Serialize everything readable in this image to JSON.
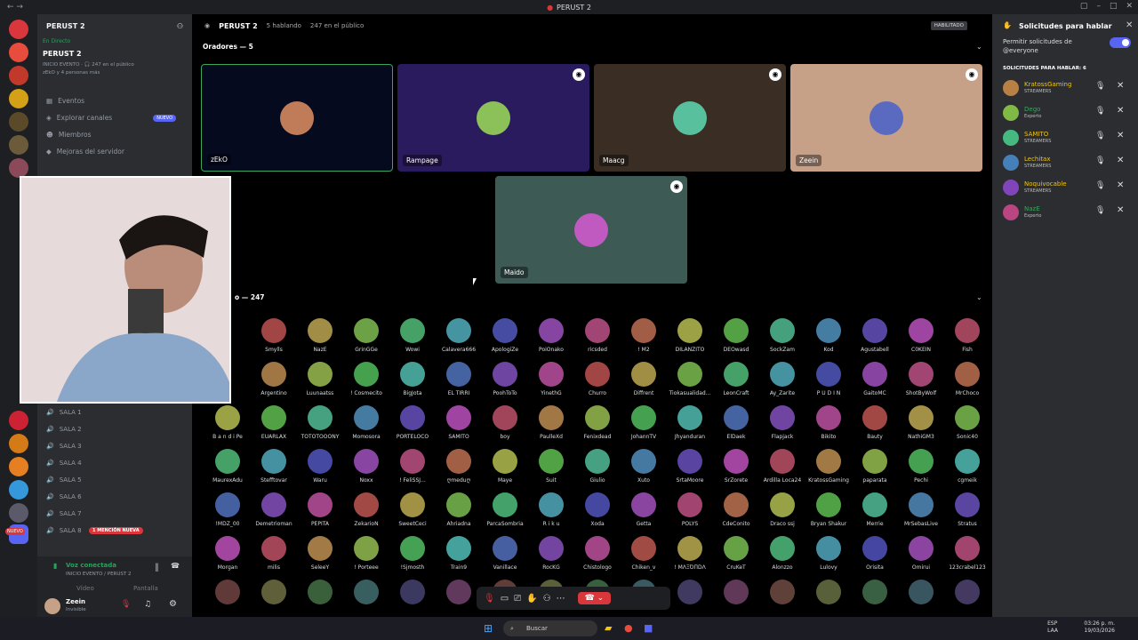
{
  "window": {
    "title": "PERUST 2"
  },
  "server": {
    "name": "PERUST 2",
    "live_label": "En Directo",
    "event_name": "PERUST 2",
    "event_sub": "INICIO EVENTO · 🎧 247 en el público",
    "event_people": "zEkO y 4 personas más"
  },
  "channel_menu": [
    {
      "label": "Eventos"
    },
    {
      "label": "Explorar canales",
      "badge": "NUEVO"
    },
    {
      "label": "Miembros"
    },
    {
      "label": "Mejoras del servidor"
    }
  ],
  "salas": [
    "SALA 1",
    "SALA 2",
    "SALA 3",
    "SALA 4",
    "SALA 5",
    "SALA 6",
    "SALA 7",
    "SALA 8"
  ],
  "mention_badge": "1 MENCIÓN NUEVA",
  "new_badge": "NUEVO",
  "voice": {
    "status": "Voz conectada",
    "channel": "INICIO EVENTO / PERUST 2",
    "video": "Vídeo",
    "screen": "Pantalla"
  },
  "user": {
    "name": "Zeein",
    "status": "Invisible"
  },
  "stage": {
    "name": "PERUST 2",
    "speaking": "5 hablando",
    "public": "247 en el público",
    "habilitado": "HABILITADO",
    "speakers_title": "Oradores — 5",
    "audience_title": "o — 247"
  },
  "speakers": [
    {
      "name": "zEkO",
      "bg": "#050a1e",
      "border": "#3ba55d",
      "icon": false
    },
    {
      "name": "Rampage",
      "bg": "#2a1a5e",
      "border": "",
      "icon": true
    },
    {
      "name": "Maacg",
      "bg": "#3a2d23",
      "border": "",
      "icon": true
    },
    {
      "name": "Zeein",
      "bg": "#c7a088",
      "border": "",
      "icon": true
    },
    {
      "name": "Maido",
      "bg": "#3d5a55",
      "border": "",
      "icon": true
    }
  ],
  "audience": [
    "Smylls",
    "NazE",
    "GrinGGe",
    "Wowi",
    "Calavera666",
    "ApologiZe",
    "PoiOnako",
    "ricsded",
    "! M2",
    "DILANZITO",
    "DEOwasd",
    "SockZam",
    "Kod",
    "Agustabell",
    "C0KEIN",
    "Fish",
    "Argentino",
    "Luunaatss",
    "! Cosmecito",
    "BigJota",
    "EL TIRRI",
    "PoohToTo",
    "YinethG",
    "Churro",
    "Diffrent",
    "Tiokasualidad...",
    "LeonCraft",
    "Ay_Zarite",
    "P U D Í N",
    "GaitoMC",
    "ShotByWolf",
    "MrChoco",
    "B a n d i Pe",
    "EUARLAX",
    "TOTOTOOONY",
    "Momosora",
    "PORTELOCO",
    "SAMITO",
    "boy",
    "PaulleXd",
    "Fenixdead",
    "JohannTV",
    "Jhyanduran",
    "ElDaek",
    "Flapjack",
    "Bikito",
    "Bauty",
    "NathiGM3",
    "Sonic40",
    "MaurexAdu",
    "Stefftovar",
    "Waru",
    "Noxx",
    "! FeliSSJ...",
    "ღmeduღ",
    "Maye",
    "Suit",
    "Giulio",
    "Xuto",
    "SrtaMoore",
    "SrZorete",
    "Ardilla Loca24",
    "KratossGaming",
    "paparata",
    "Pechi",
    "cgmeik",
    "!MDZ_00",
    "Demetrioman",
    "PEPITA",
    "ZekarioN",
    "SweetCeci",
    "Ahriadna",
    "ParcaSombria",
    "R i k u",
    "Xoda",
    "Getta",
    "POLYS",
    "CdeConito",
    "Draco ssj",
    "Bryan Shakur",
    "Merrie",
    "MrSebasLive",
    "Stratus",
    "Morgan",
    "milis",
    "SeleeY",
    "! Porteee",
    "!Sjmosth",
    "Train9",
    "Vanillacе",
    "RocKG",
    "Chistologo",
    "Chiken_v",
    "! MΛΞΌΠDΛ",
    "CruKeT",
    "Alonzzo",
    "Lulovy",
    "Orisita",
    "Omirui",
    "123crabel123"
  ],
  "requests": {
    "title": "Solicitudes para hablar",
    "permit": "Permitir solicitudes de @everyone",
    "header": "SOLICITUDES PARA HABLAR: 6",
    "items": [
      {
        "name": "KratossGaming",
        "role": "STREAMERS",
        "color": "#f1c40f"
      },
      {
        "name": "Dego",
        "role": "Experto",
        "color": "#3ba55d"
      },
      {
        "name": "SAMITO",
        "role": "STREAMERS",
        "color": "#f1c40f"
      },
      {
        "name": "Lechitax",
        "role": "STREAMERS",
        "color": "#f1c40f"
      },
      {
        "name": "Noquivocable",
        "role": "STREAMERS",
        "color": "#f1c40f"
      },
      {
        "name": "NazE",
        "role": "Experto",
        "color": "#3ba55d"
      }
    ]
  },
  "taskbar": {
    "search": "Buscar",
    "lang": "ESP\nLAA",
    "time": "03:26 p. m.",
    "date": "19/03/2026"
  },
  "colors": {
    "accent": "#5865f2",
    "green": "#23a55a",
    "red": "#da373c"
  }
}
